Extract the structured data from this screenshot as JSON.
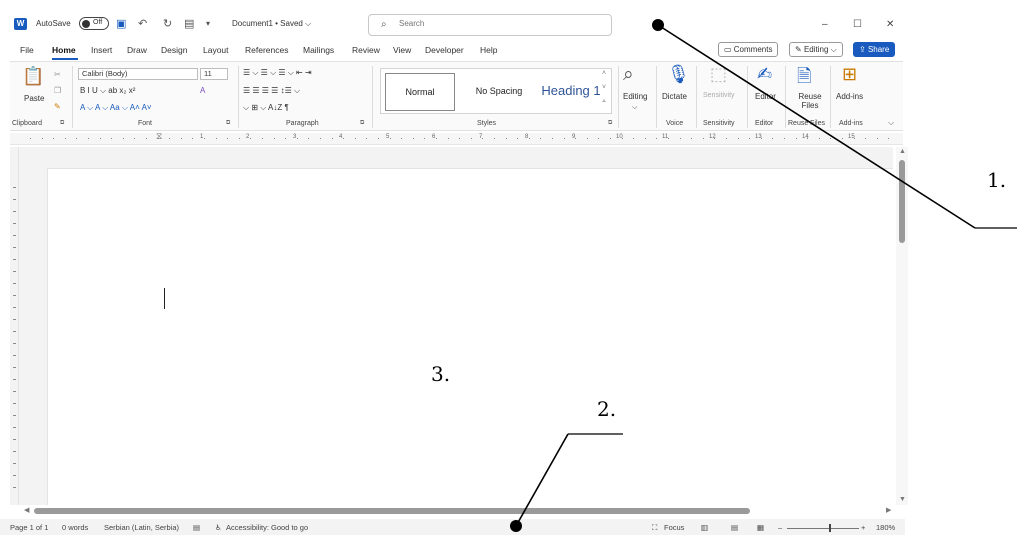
{
  "titlebar": {
    "autosave_label": "AutoSave",
    "autosave_state": "Off",
    "doc_title": "Document1 • Saved ⌵",
    "search_placeholder": "Search",
    "minimize": "–",
    "maximize": "☐",
    "close": "✕"
  },
  "tabs": [
    "File",
    "Home",
    "Insert",
    "Draw",
    "Design",
    "Layout",
    "References",
    "Mailings",
    "Review",
    "View",
    "Developer",
    "Help"
  ],
  "active_tab": "Home",
  "right_buttons": {
    "comments": "Comments",
    "editing": "Editing ⌵",
    "share": "Share"
  },
  "ribbon": {
    "clipboard": {
      "paste": "Paste",
      "label": "Clipboard"
    },
    "font": {
      "name": "Calibri (Body)",
      "size": "11",
      "label": "Font",
      "row2": "B   I   U ⌵  ab   x₂   x²",
      "row3": "A ⌵   A ⌵   Aa ⌵   A˄   A˅"
    },
    "paragraph": {
      "label": "Paragraph",
      "row1": "☰ ⌵  ☰ ⌵  ☰ ⌵   ⇤  ⇥",
      "row2": "☰  ☰  ☰  ☰   ↕☰ ⌵",
      "row3": "⌵  ⊞ ⌵   A↓Z   ¶"
    },
    "styles": {
      "label": "Styles",
      "tiles": [
        "Normal",
        "No Spacing",
        "Heading 1"
      ]
    },
    "editing": {
      "label": "Editing"
    },
    "voice": {
      "button": "Dictate",
      "label": "Voice"
    },
    "sensitivity": {
      "button": "Sensitivity",
      "label": "Sensitivity"
    },
    "editor": {
      "button": "Editor",
      "label": "Editor"
    },
    "reuse": {
      "button": "Reuse Files",
      "label": "Reuse Files"
    },
    "addins": {
      "button": "Add-ins",
      "label": "Add-ins"
    }
  },
  "ruler_numbers": [
    "1",
    "2",
    "3",
    "4",
    "5",
    "6",
    "7",
    "8",
    "9",
    "10",
    "11",
    "12",
    "13",
    "14",
    "15"
  ],
  "statusbar": {
    "page": "Page 1 of 1",
    "words": "0 words",
    "language": "Serbian (Latin, Serbia)",
    "accessibility": "Accessibility: Good to go",
    "focus": "Focus",
    "zoom_minus": "–",
    "zoom_plus": "+",
    "zoom": "180%"
  },
  "annotations": [
    "1.",
    "2.",
    "3."
  ]
}
